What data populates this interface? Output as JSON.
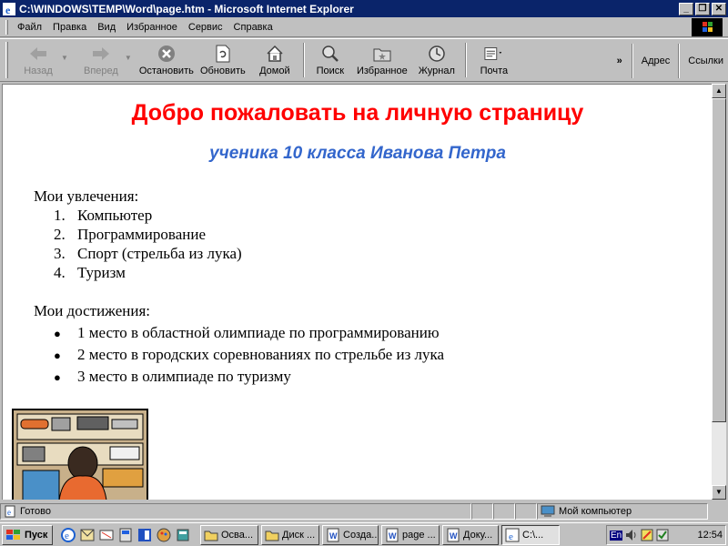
{
  "window": {
    "title": "C:\\WINDOWS\\TEMP\\Word\\page.htm - Microsoft Internet Explorer",
    "minimize_label": "_",
    "maximize_label": "❐",
    "close_label": "✕"
  },
  "menu": [
    "Файл",
    "Правка",
    "Вид",
    "Избранное",
    "Сервис",
    "Справка"
  ],
  "toolbar": {
    "back": "Назад",
    "forward": "Вперед",
    "stop": "Остановить",
    "refresh": "Обновить",
    "home": "Домой",
    "search": "Поиск",
    "favorites": "Избранное",
    "history": "Журнал",
    "mail": "Почта",
    "more": "»",
    "address": "Адрес",
    "links": "Ссылки"
  },
  "page": {
    "title": "Добро пожаловать на личную страницу",
    "subtitle": "ученика 10 класса Иванова Петра",
    "hobbies_heading": "Мои увлечения:",
    "hobbies": [
      "Компьютер",
      "Программирование",
      "Спорт (стрельба из лука)",
      "Туризм"
    ],
    "achievements_heading": "Мои достижения:",
    "achievements": [
      "1 место в областной олимпиаде по программированию",
      "2 место в городских соревнованиях по стрельбе из лука",
      "3 место в олимпиаде по туризму"
    ]
  },
  "status": {
    "text": "Готово",
    "zone": "Мой компьютер"
  },
  "taskbar": {
    "start": "Пуск",
    "buttons": [
      "Осва...",
      "Диск ...",
      "Созда...",
      "page ...",
      "Доку...",
      "C:\\..."
    ],
    "lang": "En",
    "clock": "12:54"
  },
  "colors": {
    "title_red": "#ff0000",
    "subtitle_blue": "#3366cc",
    "titlebar": "#0a246a"
  }
}
